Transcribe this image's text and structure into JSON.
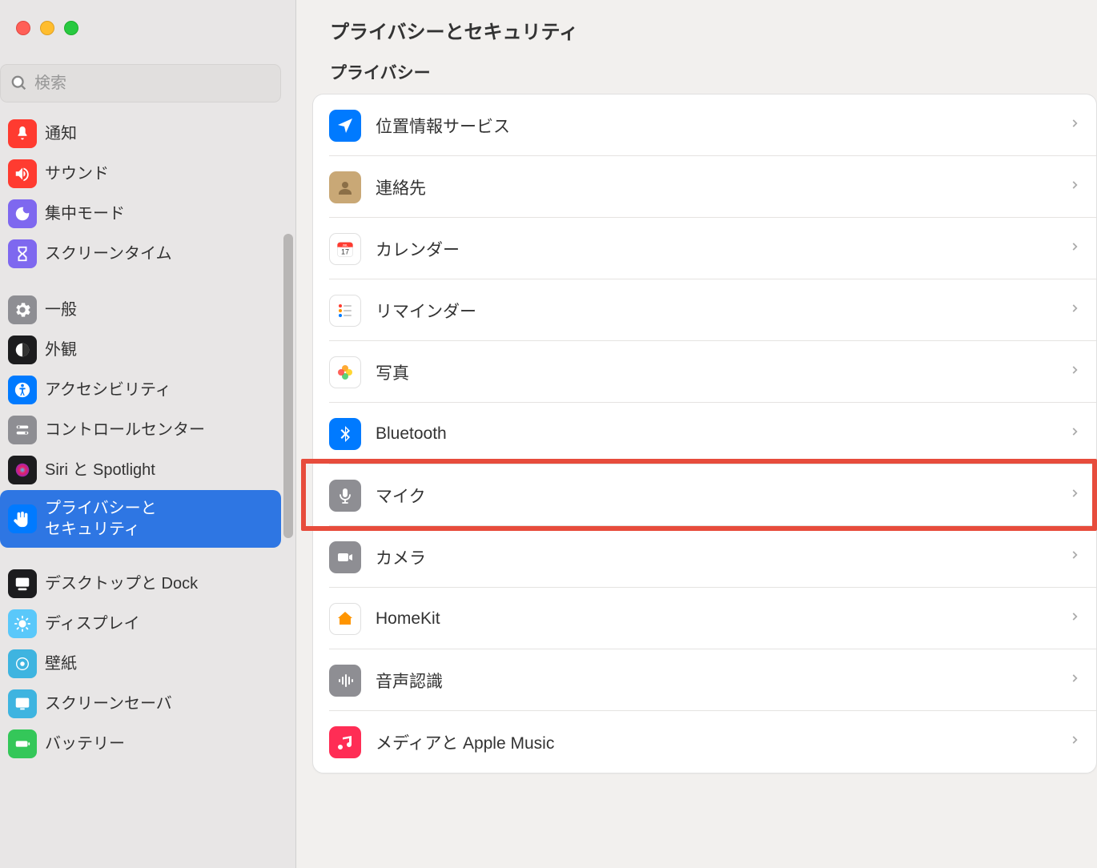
{
  "search": {
    "placeholder": "検索"
  },
  "sidebar": {
    "items": [
      {
        "label": "通知",
        "icon": "bell",
        "bg": "bg-red"
      },
      {
        "label": "サウンド",
        "icon": "speaker",
        "bg": "bg-red"
      },
      {
        "label": "集中モード",
        "icon": "moon",
        "bg": "bg-purple"
      },
      {
        "label": "スクリーンタイム",
        "icon": "hourglass",
        "bg": "bg-purple"
      },
      {
        "label": "一般",
        "icon": "gear",
        "bg": "bg-gray"
      },
      {
        "label": "外観",
        "icon": "appearance",
        "bg": "bg-black"
      },
      {
        "label": "アクセシビリティ",
        "icon": "accessibility",
        "bg": "bg-blue"
      },
      {
        "label": "コントロールセンター",
        "icon": "switches",
        "bg": "bg-gray"
      },
      {
        "label": "Siri と Spotlight",
        "icon": "siri",
        "bg": "bg-black"
      },
      {
        "label": "プライバシーと\nセキュリティ",
        "icon": "hand",
        "bg": "bg-blue",
        "selected": true
      },
      {
        "label": "デスクトップと Dock",
        "icon": "dock",
        "bg": "bg-black"
      },
      {
        "label": "ディスプレイ",
        "icon": "display",
        "bg": "bg-teal"
      },
      {
        "label": "壁紙",
        "icon": "wallpaper",
        "bg": "bg-cyan"
      },
      {
        "label": "スクリーンセーバ",
        "icon": "screensaver",
        "bg": "bg-cyan"
      },
      {
        "label": "バッテリー",
        "icon": "battery",
        "bg": "bg-green"
      }
    ]
  },
  "main": {
    "title": "プライバシーとセキュリティ",
    "section": "プライバシー",
    "rows": [
      {
        "label": "位置情報サービス",
        "icon": "location",
        "bg": "bg-blue"
      },
      {
        "label": "連絡先",
        "icon": "contacts",
        "bg": "bg-tan"
      },
      {
        "label": "カレンダー",
        "icon": "calendar",
        "bg": "bg-white"
      },
      {
        "label": "リマインダー",
        "icon": "reminders",
        "bg": "bg-white"
      },
      {
        "label": "写真",
        "icon": "photos",
        "bg": "bg-white"
      },
      {
        "label": "Bluetooth",
        "icon": "bluetooth",
        "bg": "bg-blue"
      },
      {
        "label": "マイク",
        "icon": "microphone",
        "bg": "bg-gray",
        "highlighted": true
      },
      {
        "label": "カメラ",
        "icon": "camera",
        "bg": "bg-gray"
      },
      {
        "label": "HomeKit",
        "icon": "homekit",
        "bg": "bg-white"
      },
      {
        "label": "音声認識",
        "icon": "waveform",
        "bg": "bg-gray"
      },
      {
        "label": "メディアと Apple Music",
        "icon": "music",
        "bg": "bg-pink"
      }
    ]
  }
}
